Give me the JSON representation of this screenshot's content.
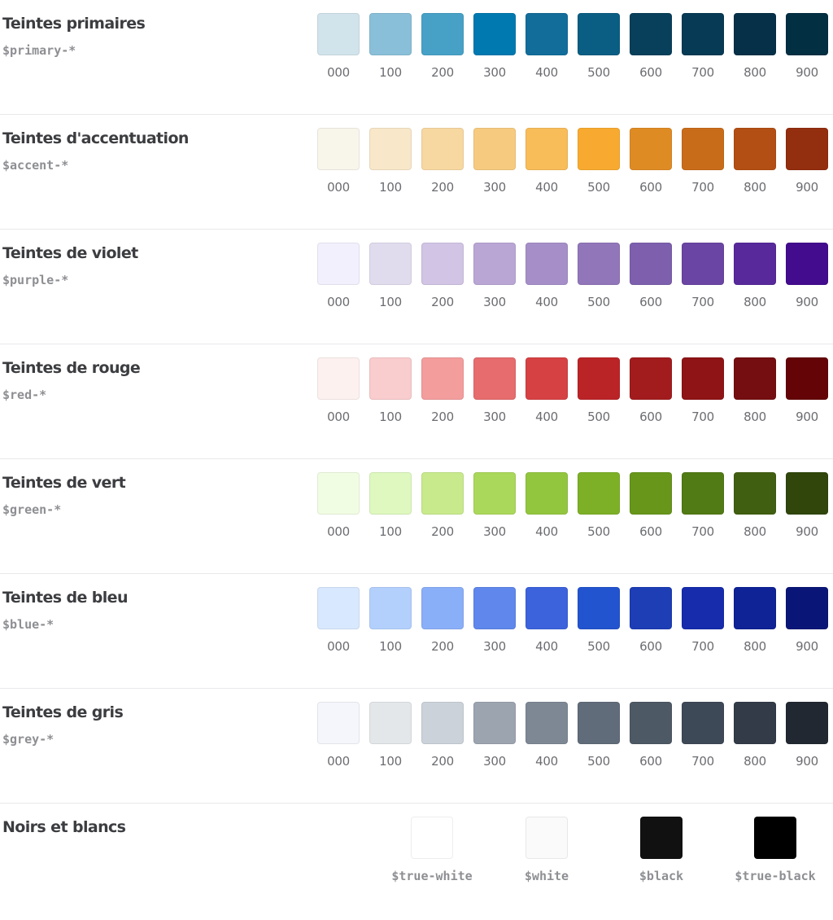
{
  "shade_labels": [
    "000",
    "100",
    "200",
    "300",
    "400",
    "500",
    "600",
    "700",
    "800",
    "900"
  ],
  "groups": [
    {
      "title": "Teintes primaires",
      "variable": "$primary-*",
      "colors": [
        "#d1e3eb",
        "#89bfd8",
        "#47a1c6",
        "#0079b0",
        "#126d9b",
        "#0b5e83",
        "#08405c",
        "#073a54",
        "#053048",
        "#032f43"
      ]
    },
    {
      "title": "Teintes d'accentuation",
      "variable": "$accent-*",
      "colors": [
        "#f8f6eb",
        "#f8e7c8",
        "#f8d8a1",
        "#f7cb7f",
        "#f8bc59",
        "#f8aa30",
        "#df8b24",
        "#c96c19",
        "#b34f14",
        "#932e0f"
      ]
    },
    {
      "title": "Teintes de violet",
      "variable": "$purple-*",
      "colors": [
        "#f3f0fd",
        "#e1dbee",
        "#d1c4e4",
        "#b9a6d5",
        "#a68fc8",
        "#9276ba",
        "#7d5fae",
        "#6a45a3",
        "#57299b",
        "#430b8e"
      ]
    },
    {
      "title": "Teintes de rouge",
      "variable": "$red-*",
      "colors": [
        "#fdf1f0",
        "#f9cccd",
        "#f39d9c",
        "#e66c6d",
        "#d64143",
        "#bb2427",
        "#a21c1e",
        "#8f1415",
        "#750e10",
        "#650406"
      ]
    },
    {
      "title": "Teintes de vert",
      "variable": "$green-*",
      "colors": [
        "#f1fde3",
        "#def8bf",
        "#c8ea8c",
        "#aad85b",
        "#93c63f",
        "#7db027",
        "#67961b",
        "#517b14",
        "#415f10",
        "#30460b"
      ]
    },
    {
      "title": "Teintes de bleu",
      "variable": "$blue-*",
      "colors": [
        "#d8e8fe",
        "#b3d0fd",
        "#8aaff9",
        "#5f87ec",
        "#3c62dc",
        "#2354cf",
        "#1d3eb5",
        "#162cad",
        "#0f2296",
        "#0a1677"
      ]
    },
    {
      "title": "Teintes de gris",
      "variable": "$grey-*",
      "colors": [
        "#f5f6fb",
        "#e4e7ea",
        "#cbd2da",
        "#9ca4b0",
        "#7e8895",
        "#616c7a",
        "#4e5966",
        "#3e4957",
        "#323b47",
        "#222831"
      ]
    }
  ],
  "bw": {
    "title": "Noirs et blancs",
    "items": [
      {
        "label": "$true-white",
        "color": "#ffffff"
      },
      {
        "label": "$white",
        "color": "#fafafa"
      },
      {
        "label": "$black",
        "color": "#111111"
      },
      {
        "label": "$true-black",
        "color": "#000000"
      }
    ]
  }
}
